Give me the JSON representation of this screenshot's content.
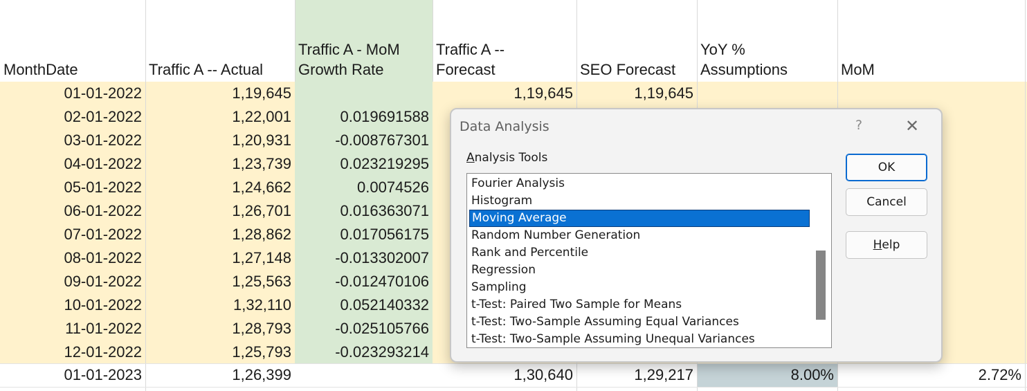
{
  "colors": {
    "date_fill": "#fff2cc",
    "growth_fill": "#d9ead3",
    "yoy_fill": "#c5d3d7",
    "selection": "#0a71d3"
  },
  "headers": {
    "col_b": "MonthDate",
    "col_c": "Traffic A -- Actual",
    "col_d_line1": "Traffic A - MoM",
    "col_d_line2": "Growth Rate",
    "col_e_line1": "Traffic A --",
    "col_e_line2": "Forecast",
    "col_f": "SEO Forecast",
    "col_g_line1": "YoY %",
    "col_g_line2": "Assumptions",
    "col_h": "MoM"
  },
  "rows": [
    {
      "date": "01-01-2022",
      "actual": "1,19,645",
      "growth": "",
      "forecast": "1,19,645",
      "seo": "1,19,645",
      "yoy": "",
      "mom": ""
    },
    {
      "date": "02-01-2022",
      "actual": "1,22,001",
      "growth": "0.019691588",
      "forecast": "",
      "seo": "",
      "yoy": "",
      "mom": ""
    },
    {
      "date": "03-01-2022",
      "actual": "1,20,931",
      "growth": "-0.008767301",
      "forecast": "",
      "seo": "",
      "yoy": "",
      "mom": ""
    },
    {
      "date": "04-01-2022",
      "actual": "1,23,739",
      "growth": "0.023219295",
      "forecast": "",
      "seo": "",
      "yoy": "",
      "mom": ""
    },
    {
      "date": "05-01-2022",
      "actual": "1,24,662",
      "growth": "0.0074526",
      "forecast": "",
      "seo": "",
      "yoy": "",
      "mom": ""
    },
    {
      "date": "06-01-2022",
      "actual": "1,26,701",
      "growth": "0.016363071",
      "forecast": "",
      "seo": "",
      "yoy": "",
      "mom": ""
    },
    {
      "date": "07-01-2022",
      "actual": "1,28,862",
      "growth": "0.017056175",
      "forecast": "",
      "seo": "",
      "yoy": "",
      "mom": ""
    },
    {
      "date": "08-01-2022",
      "actual": "1,27,148",
      "growth": "-0.013302007",
      "forecast": "",
      "seo": "",
      "yoy": "",
      "mom": ""
    },
    {
      "date": "09-01-2022",
      "actual": "1,25,563",
      "growth": "-0.012470106",
      "forecast": "",
      "seo": "",
      "yoy": "",
      "mom": ""
    },
    {
      "date": "10-01-2022",
      "actual": "1,32,110",
      "growth": "0.052140332",
      "forecast": "",
      "seo": "",
      "yoy": "",
      "mom": ""
    },
    {
      "date": "11-01-2022",
      "actual": "1,28,793",
      "growth": "-0.025105766",
      "forecast": "",
      "seo": "",
      "yoy": "",
      "mom": ""
    },
    {
      "date": "12-01-2022",
      "actual": "1,25,793",
      "growth": "-0.023293214",
      "forecast": "",
      "seo": "",
      "yoy": "",
      "mom": ""
    },
    {
      "date": "01-01-2023",
      "actual": "1,26,399",
      "growth": "",
      "forecast": "1,30,640",
      "seo": "1,29,217",
      "yoy": "8.00%",
      "mom": "2.72%"
    }
  ],
  "dialog": {
    "title": "Data Analysis",
    "help_glyph": "?",
    "close_glyph": "✕",
    "list_label_accel": "A",
    "list_label_rest": "nalysis Tools",
    "tools": [
      "Fourier Analysis",
      "Histogram",
      "Moving Average",
      "Random Number Generation",
      "Rank and Percentile",
      "Regression",
      "Sampling",
      "t-Test: Paired Two Sample for Means",
      "t-Test: Two-Sample Assuming Equal Variances",
      "t-Test: Two-Sample Assuming Unequal Variances"
    ],
    "selected_tool": "Moving Average",
    "ok_label": "OK",
    "cancel_label": "Cancel",
    "help_accel": "H",
    "help_rest": "elp",
    "scroll_icon": "scrollbar-thumb"
  }
}
